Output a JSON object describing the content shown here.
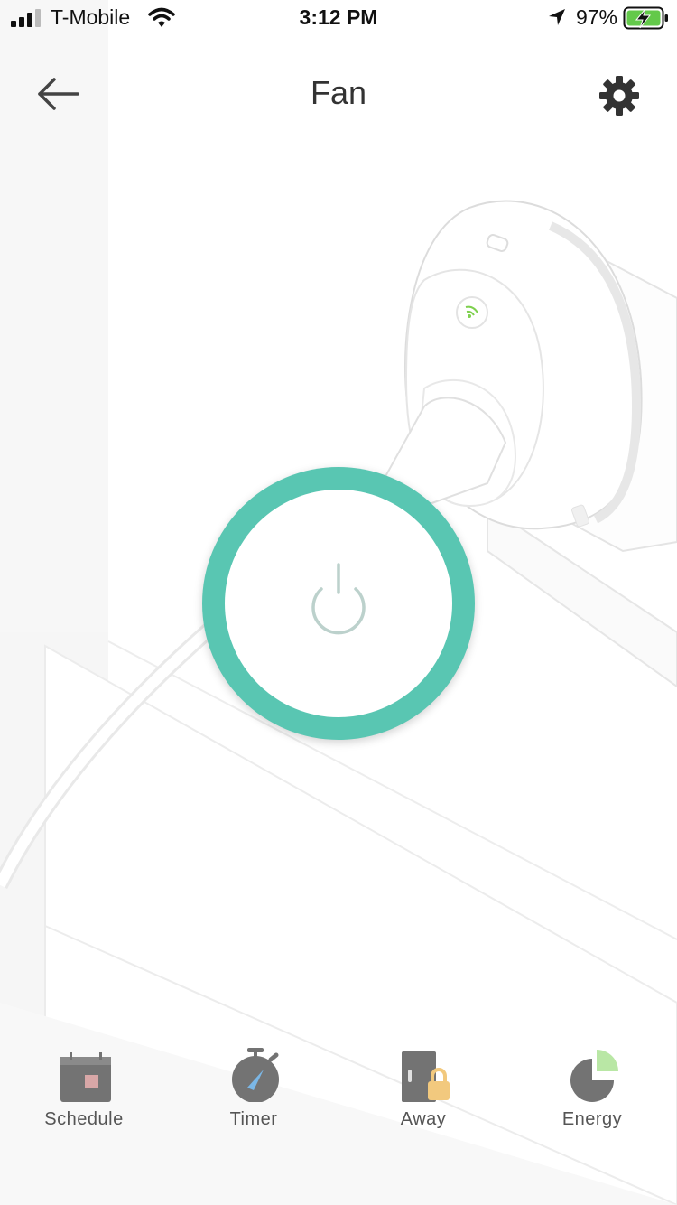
{
  "status_bar": {
    "carrier": "T-Mobile",
    "time": "3:12 PM",
    "battery_percent": "97%"
  },
  "header": {
    "title": "Fan",
    "back_icon": "arrow-left-icon",
    "settings_icon": "gear-icon"
  },
  "power": {
    "icon": "power-icon",
    "ring_color": "#59c6b2"
  },
  "bottom_nav": {
    "items": [
      {
        "label": "Schedule",
        "icon": "calendar-icon"
      },
      {
        "label": "Timer",
        "icon": "stopwatch-icon"
      },
      {
        "label": "Away",
        "icon": "door-lock-icon"
      },
      {
        "label": "Energy",
        "icon": "pie-chart-icon"
      }
    ]
  },
  "colors": {
    "accent": "#59c6b2",
    "icon_gray": "#737373",
    "energy_green": "#b9e7a5",
    "away_lock": "#f2c97e",
    "timer_needle": "#7bb7e6",
    "schedule_mark": "#d8a7a7"
  }
}
